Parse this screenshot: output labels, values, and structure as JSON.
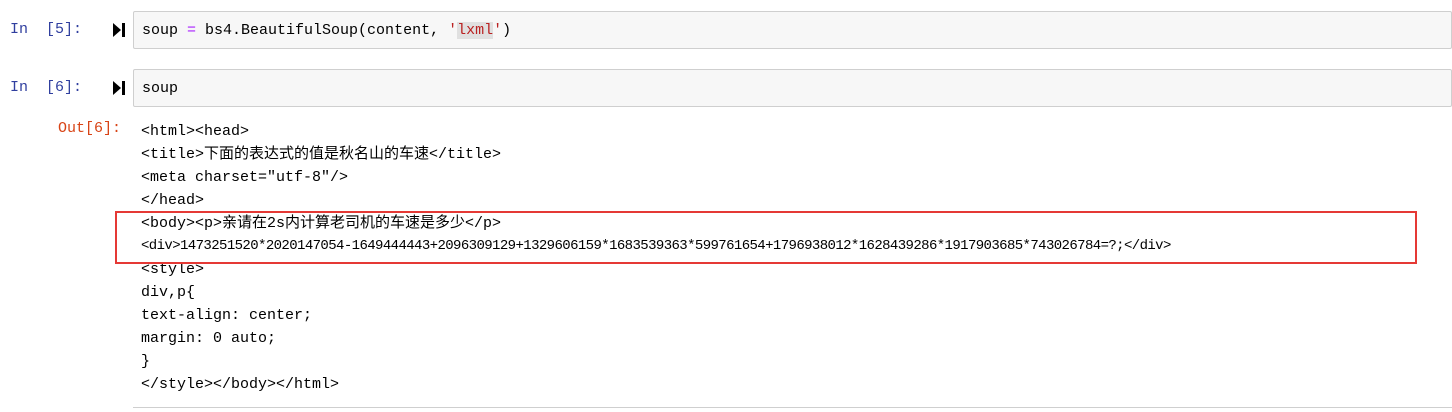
{
  "cells": [
    {
      "prompt": "In  [5]:",
      "code": {
        "prefix": "soup ",
        "op": "=",
        "middle": " bs4.BeautifulSoup(content, ",
        "quote_open": "'",
        "string": "lxml",
        "quote_close": "'",
        "suffix": ")"
      }
    },
    {
      "prompt": "In  [6]:",
      "code_text": "soup",
      "out_prompt": "Out[6]:",
      "output_lines": [
        "<html><head>",
        "<title>下面的表达式的值是秋名山的车速</title>",
        "<meta charset=\"utf-8\"/>",
        "</head>",
        "<body><p>亲请在2s内计算老司机的车速是多少</p>",
        "<div>1473251520*2020147054-1649444443+2096309129+1329606159*1683539363*599761654+1796938012*1628439286*1917903685*743026784=?;</div>",
        "<style>",
        "div,p{",
        "text-align: center;",
        "margin: 0 auto;",
        "}",
        "</style></body></html>"
      ]
    }
  ],
  "colors": {
    "in_prompt": "#303f9f",
    "out_prompt": "#d84315",
    "highlight": "#e53935",
    "input_bg": "#f7f7f7"
  },
  "icons": {
    "run": "run-cell-icon"
  }
}
